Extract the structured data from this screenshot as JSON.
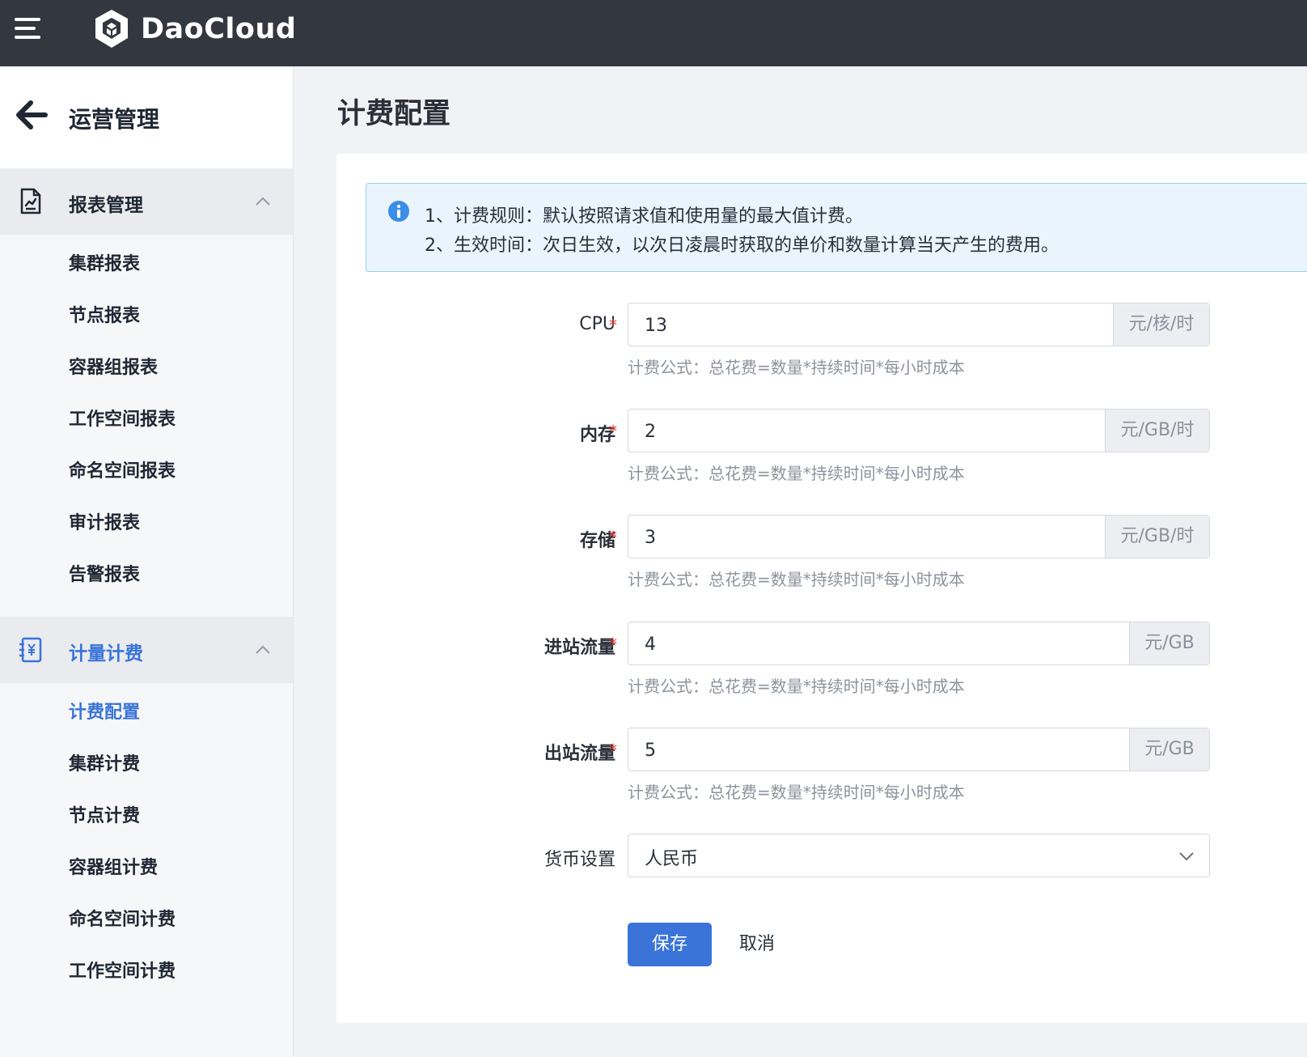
{
  "header": {
    "brand": "DaoCloud",
    "menu_icon": "hamburger-icon",
    "logo_icon": "daocloud-logo-icon"
  },
  "sidebar": {
    "back_title": "运营管理",
    "groups": [
      {
        "label": "报表管理",
        "icon": "report-icon",
        "items": [
          "集群报表",
          "节点报表",
          "容器组报表",
          "工作空间报表",
          "命名空间报表",
          "审计报表",
          "告警报表"
        ]
      },
      {
        "label": "计量计费",
        "icon": "billing-icon",
        "items": [
          "计费配置",
          "集群计费",
          "节点计费",
          "容器组计费",
          "命名空间计费",
          "工作空间计费"
        ]
      }
    ],
    "active_item": "计费配置"
  },
  "main": {
    "title": "计费配置",
    "alert": {
      "line1": "1、计费规则：默认按照请求值和使用量的最大值计费。",
      "line2": "2、生效时间：次日生效，以次日凌晨时获取的单价和数量计算当天产生的费用。"
    },
    "form": {
      "fields": [
        {
          "label": "CPU",
          "value": "13",
          "unit": "元/核/时",
          "hint": "计费公式：总花费=数量*持续时间*每小时成本"
        },
        {
          "label": "内存",
          "value": "2",
          "unit": "元/GB/时",
          "hint": "计费公式：总花费=数量*持续时间*每小时成本"
        },
        {
          "label": "存储",
          "value": "3",
          "unit": "元/GB/时",
          "hint": "计费公式：总花费=数量*持续时间*每小时成本"
        },
        {
          "label": "进站流量",
          "value": "4",
          "unit": "元/GB",
          "hint": "计费公式：总花费=数量*持续时间*每小时成本"
        },
        {
          "label": "出站流量",
          "value": "5",
          "unit": "元/GB",
          "hint": "计费公式：总花费=数量*持续时间*每小时成本"
        }
      ],
      "currency_label": "货币设置",
      "currency_value": "人民币",
      "required_mark": "*"
    },
    "save_label": "保存",
    "cancel_label": "取消"
  },
  "colors": {
    "topbar": "#33373f",
    "accent": "#3a74d9",
    "required": "#e03d3d",
    "alert_bg": "#e9f4fc"
  }
}
